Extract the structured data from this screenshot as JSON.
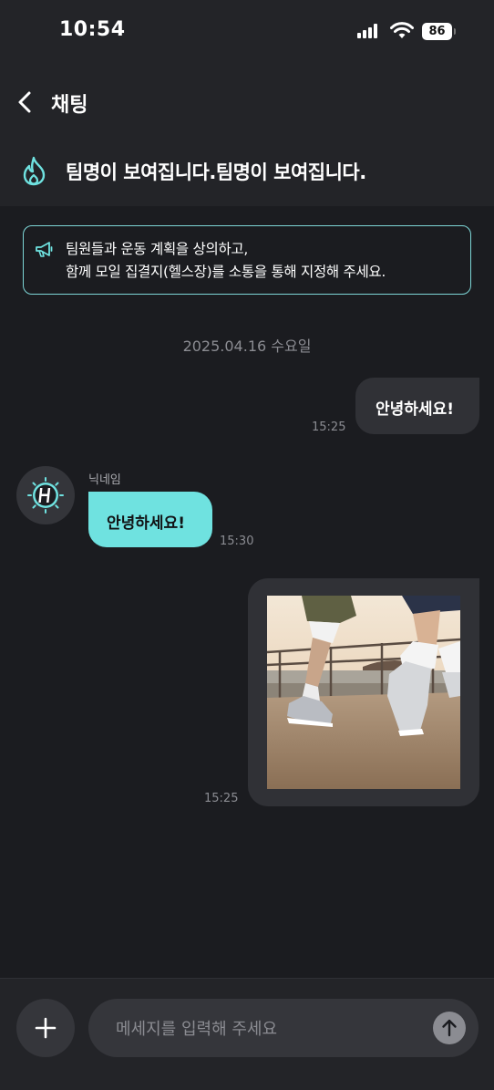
{
  "status_bar": {
    "time": "10:54",
    "battery": "86"
  },
  "header": {
    "title": "채팅"
  },
  "team": {
    "name": "팀명이 보여집니다.팀명이 보여집니다."
  },
  "notice": {
    "line1": "팀원들과 운동 계획을 상의하고,",
    "line2": "함께 모일 집결지(헬스장)를 소통을 통해 지정해 주세요."
  },
  "date_separator": "2025.04.16 수요일",
  "messages": [
    {
      "sender": "me",
      "text": "안녕하세요!",
      "time": "15:25"
    },
    {
      "sender": "other",
      "nickname": "닉네임",
      "text": "안녕하세요!",
      "time": "15:30"
    },
    {
      "sender": "me",
      "type": "image",
      "time": "15:25"
    }
  ],
  "composer": {
    "placeholder": "메세지를 입력해 주세요",
    "value": ""
  },
  "colors": {
    "accent": "#6fe2e0",
    "background": "#1b1c20",
    "bar": "#232428",
    "bubble": "#303136"
  }
}
